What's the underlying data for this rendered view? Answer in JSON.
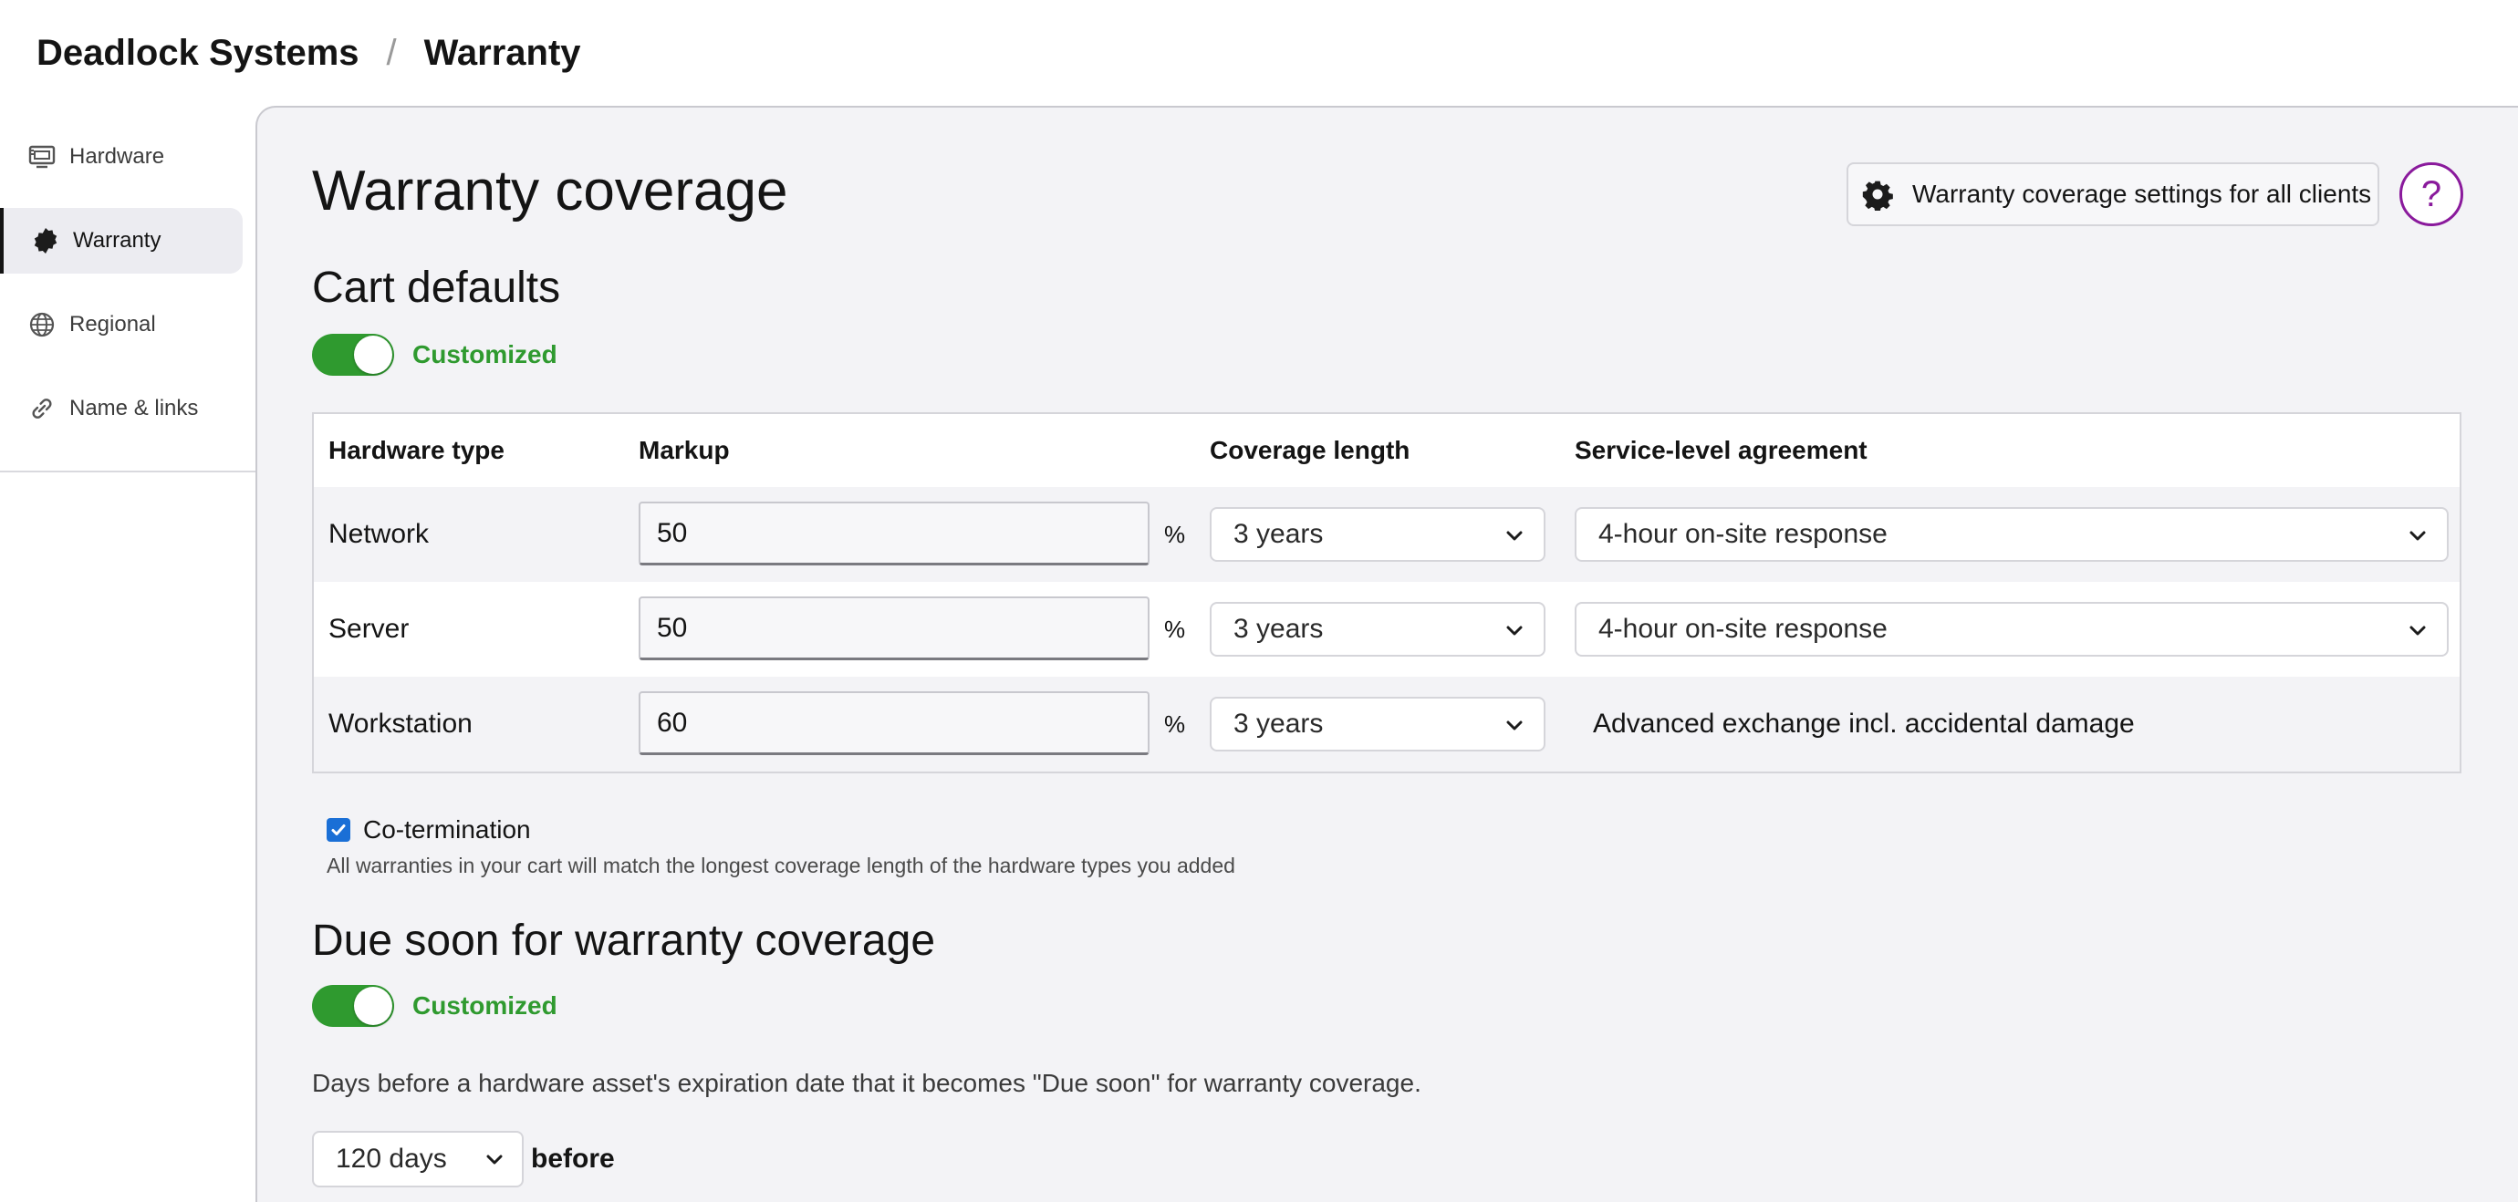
{
  "breadcrumb": {
    "org": "Deadlock Systems",
    "separator": "/",
    "page": "Warranty"
  },
  "sidebar": {
    "items": [
      {
        "label": "Hardware",
        "icon": "hardware-icon"
      },
      {
        "label": "Warranty",
        "icon": "warranty-badge-icon",
        "active": true
      },
      {
        "label": "Regional",
        "icon": "globe-icon"
      },
      {
        "label": "Name & links",
        "icon": "link-icon"
      }
    ]
  },
  "main": {
    "title": "Warranty coverage",
    "settings_button": "Warranty coverage settings for all clients",
    "help_button": "?",
    "cart_defaults": {
      "title": "Cart defaults",
      "toggle_label": "Customized",
      "toggle_on": true,
      "columns": [
        "Hardware type",
        "Markup",
        "Coverage length",
        "Service-level agreement"
      ],
      "rows": [
        {
          "type": "Network",
          "markup": "50",
          "unit": "%",
          "coverage": "3 years",
          "sla": "4-hour on-site response",
          "sla_is_select": true
        },
        {
          "type": "Server",
          "markup": "50",
          "unit": "%",
          "coverage": "3 years",
          "sla": "4-hour on-site response",
          "sla_is_select": true
        },
        {
          "type": "Workstation",
          "markup": "60",
          "unit": "%",
          "coverage": "3 years",
          "sla": "Advanced exchange incl. accidental damage",
          "sla_is_select": false
        }
      ],
      "cotermination_label": "Co-termination",
      "cotermination_checked": true,
      "cotermination_help": "All warranties in your cart will match the longest coverage length of the hardware types you added"
    },
    "due_soon": {
      "title": "Due soon for warranty coverage",
      "toggle_label": "Customized",
      "toggle_on": true,
      "description": "Days before a hardware asset's expiration date that it becomes \"Due soon\" for warranty coverage.",
      "days": "120 days",
      "suffix": "before"
    }
  },
  "colors": {
    "toggle_on": "#2f9a2f",
    "help_accent": "#8a1a9c",
    "checkbox": "#1a6fd6"
  }
}
